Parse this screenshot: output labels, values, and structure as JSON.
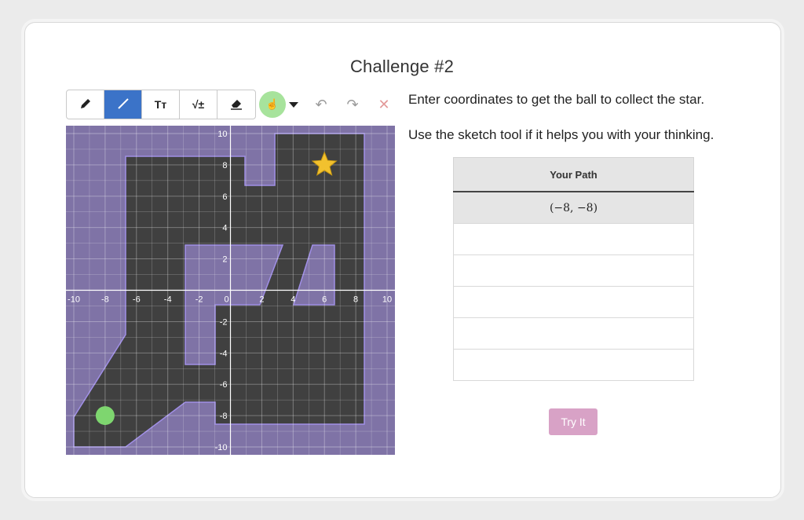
{
  "title": "Challenge #2",
  "toolbar": {
    "tools": [
      {
        "name": "pencil-icon",
        "glyph": "✏"
      },
      {
        "name": "line-icon",
        "glyph": "╱"
      },
      {
        "name": "text-icon",
        "glyph": "Tт"
      },
      {
        "name": "math-icon",
        "glyph": "√±"
      },
      {
        "name": "eraser-icon",
        "glyph": "⌫"
      }
    ],
    "active_tool": 1,
    "color": "#a7e39c",
    "undo_glyph": "↶",
    "redo_glyph": "↷",
    "clear_glyph": "✕"
  },
  "graph": {
    "xlim": [
      -10,
      10
    ],
    "ylim": [
      -10,
      10
    ],
    "x_ticks": [
      "-10",
      "-8",
      "-6",
      "-4",
      "-2",
      "0",
      "2",
      "4",
      "6",
      "8",
      "10"
    ],
    "y_ticks": [
      "10",
      "8",
      "6",
      "4",
      "2",
      "-2",
      "-4",
      "-6",
      "-8",
      "-10"
    ],
    "background_color": "#7f73a6",
    "region_color": "#404040",
    "ball": {
      "x": -8,
      "y": -8,
      "color": "#7ed66f"
    },
    "star": {
      "x": 6,
      "y": 8,
      "color": "#f2c12e"
    }
  },
  "instructions": {
    "line1": "Enter coordinates to get the ball to collect the star.",
    "line2": "Use the sketch tool if it helps you with your thinking."
  },
  "path_table": {
    "header": "Your Path",
    "rows": [
      "(−8, −8)",
      "",
      "",
      "",
      "",
      ""
    ]
  },
  "try_button": "Try It",
  "accent_color": "#3b73c8"
}
